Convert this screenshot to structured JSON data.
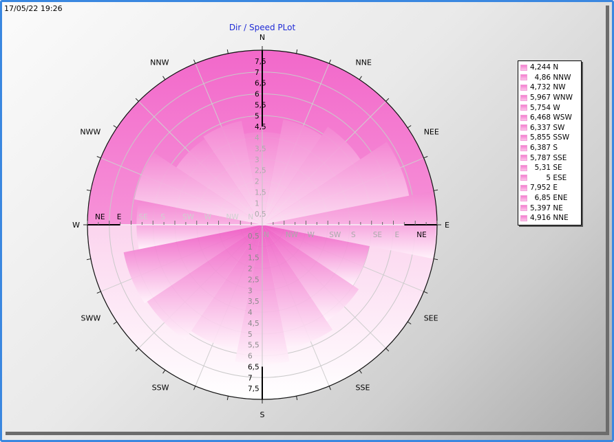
{
  "timestamp": "17/05/22 19:26",
  "chart_data": {
    "type": "polar-bar",
    "title": "Dir / Speed PLot",
    "compass_labels": [
      "N",
      "NNE",
      "NEE",
      "E",
      "SEE",
      "SSE",
      "S",
      "SSW",
      "SWW",
      "W",
      "NWW",
      "NNW"
    ],
    "radial_ticks": [
      "0",
      "0,5",
      "1",
      "1,5",
      "2",
      "2,5",
      "3",
      "3,5",
      "4",
      "4,5",
      "5",
      "5,5",
      "6",
      "6,5",
      "7",
      "7,5"
    ],
    "radial_max": 8,
    "axis_labels_upper_right": [
      "N",
      "NW",
      "W",
      "SW",
      "S",
      "SE",
      "E",
      "NE"
    ],
    "axis_labels_upper_left": [
      "NE",
      "E",
      "SE",
      "S",
      "SW",
      "W",
      "NW",
      "N"
    ],
    "series": [
      {
        "name": "N",
        "value": 4.244,
        "label": "4,244 N"
      },
      {
        "name": "NNW",
        "value": 4.86,
        "label": "  4,86 NNW"
      },
      {
        "name": "NW",
        "value": 4.732,
        "label": "4,732 NW"
      },
      {
        "name": "WNW",
        "value": 5.967,
        "label": "5,967 WNW"
      },
      {
        "name": "W",
        "value": 5.754,
        "label": "5,754 W"
      },
      {
        "name": "WSW",
        "value": 6.468,
        "label": "6,468 WSW"
      },
      {
        "name": "SW",
        "value": 6.337,
        "label": "6,337 SW"
      },
      {
        "name": "SSW",
        "value": 5.855,
        "label": "5,855 SSW"
      },
      {
        "name": "S",
        "value": 6.387,
        "label": "6,387 S"
      },
      {
        "name": "SSE",
        "value": 5.787,
        "label": "5,787 SSE"
      },
      {
        "name": "SE",
        "value": 5.31,
        "label": "  5,31 SE"
      },
      {
        "name": "ESE",
        "value": 5,
        "label": "       5 ESE"
      },
      {
        "name": "E",
        "value": 7.952,
        "label": "7,952 E"
      },
      {
        "name": "ENE",
        "value": 6.85,
        "label": "  6,85 ENE"
      },
      {
        "name": "NE",
        "value": 5.397,
        "label": "5,397 NE"
      },
      {
        "name": "NNE",
        "value": 4.916,
        "label": "4,916 NNE"
      }
    ],
    "colors": {
      "fill_dark": "#f065c8",
      "fill_light": "#fde4f4",
      "frame": "#3a87e0",
      "title": "#1f2bd6"
    },
    "grid": true,
    "legend_position": "right"
  }
}
